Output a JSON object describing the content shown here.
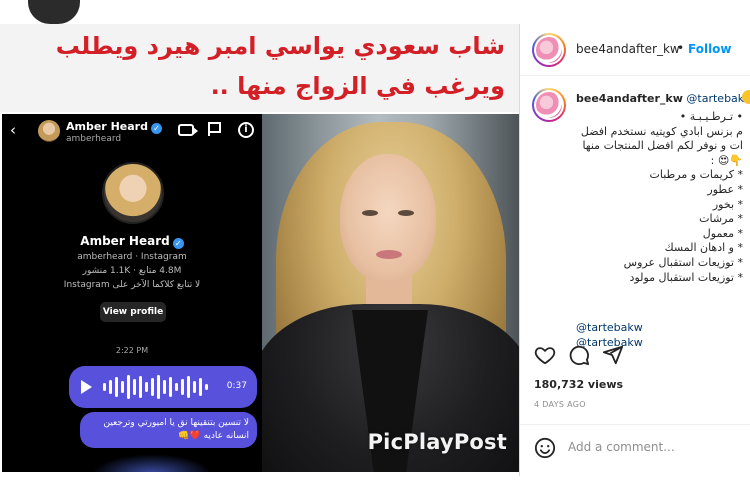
{
  "media": {
    "headline_line1": "شاب سعودي يواسي امبر هيرد ويطلب",
    "headline_line2": "ويرغب في الزواج منها ..",
    "watermark": "PicPlayPost",
    "phone": {
      "name": "Amber Heard",
      "handle": "amberheard",
      "profile_name": "Amber Heard",
      "profile_sub": "amberheard · Instagram",
      "stats": "4.8M متابع · 1.1K منشور",
      "follow_note": "لا تتابع كلاكما الآخر على Instagram",
      "view_profile": "View profile",
      "time": "2:22 PM",
      "voice_duration": "0:37",
      "message": "لا تنسين بتنقينها نق يا اميورتي وترجعين انسانه عاديه ❤️👊"
    }
  },
  "post": {
    "username": "bee4andafter_kw",
    "dot": "•",
    "follow_label": "Follow",
    "caption_user": "bee4andafter_kw",
    "caption_mention": "@tartebakw",
    "caption_lines": [
      "• تـرطـيـبـة •",
      "م بزنس ابادي كويتيه نستخدم افضل",
      "ات و نوفر لكم افضل المنتجات منها",
      "👇😍 :",
      "* كريمات و مرطبات",
      "* عطور",
      "* بخور",
      "* مرشات",
      "* معمول",
      "* و ادهان المسك",
      "* توزيعات استقبال عروس",
      "* توزيعات استقبال مولود"
    ],
    "tags": [
      "@tartebakw",
      "@tartebakw"
    ],
    "views": "180,732 views",
    "time_ago": "4 DAYS AGO",
    "comment_placeholder": "Add a comment..."
  },
  "colors": {
    "headline_red": "#d31f26",
    "instagram_blue": "#0095f6",
    "mention_blue": "#00376b",
    "dm_purple": "#5851db"
  }
}
